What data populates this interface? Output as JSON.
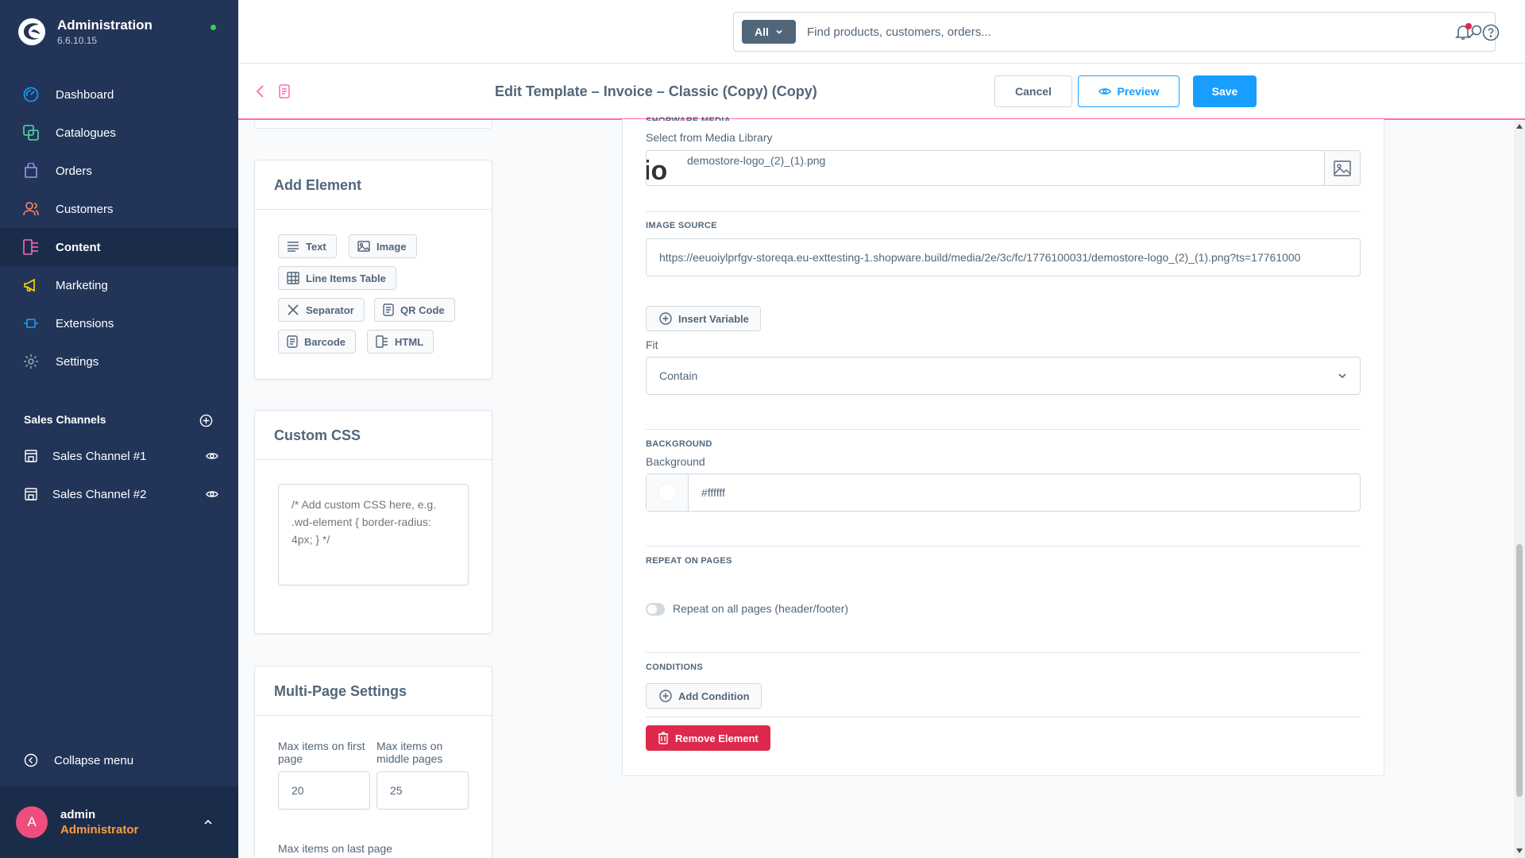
{
  "brand": {
    "title": "Administration",
    "version": "6.6.10.15"
  },
  "nav": [
    {
      "label": "Dashboard",
      "icon": "dashboard-icon",
      "color": "#189eff"
    },
    {
      "label": "Catalogues",
      "icon": "catalogues-icon",
      "color": "#57d9a3"
    },
    {
      "label": "Orders",
      "icon": "orders-icon",
      "color": "#a092f0"
    },
    {
      "label": "Customers",
      "icon": "customers-icon",
      "color": "#f88962"
    },
    {
      "label": "Content",
      "icon": "content-icon",
      "color": "#ff68b4",
      "active": true
    },
    {
      "label": "Marketing",
      "icon": "marketing-icon",
      "color": "#ffd700"
    },
    {
      "label": "Extensions",
      "icon": "extensions-icon",
      "color": "#189eff"
    },
    {
      "label": "Settings",
      "icon": "settings-icon",
      "color": "#9aa8b5"
    }
  ],
  "sales_channels": {
    "title": "Sales Channels",
    "items": [
      {
        "label": "Sales Channel #1"
      },
      {
        "label": "Sales Channel #2"
      }
    ]
  },
  "collapse_label": "Collapse menu",
  "user": {
    "initial": "A",
    "name": "admin",
    "role": "Administrator"
  },
  "search": {
    "scope": "All",
    "placeholder": "Find products, customers, orders..."
  },
  "smartbar": {
    "title": "Edit Template – Invoice – Classic (Copy) (Copy)",
    "cancel": "Cancel",
    "preview": "Preview",
    "save": "Save"
  },
  "add_element": {
    "title": "Add Element",
    "buttons": {
      "text": "Text",
      "image": "Image",
      "line_items": "Line Items Table",
      "separator": "Separator",
      "qr": "QR Code",
      "barcode": "Barcode",
      "html": "HTML"
    }
  },
  "custom_css": {
    "title": "Custom CSS",
    "placeholder": "/* Add custom CSS here, e.g. .wd-element { border-radius: 4px; } */"
  },
  "multipage": {
    "title": "Multi-Page Settings",
    "first_label": "Max items on first page",
    "first_value": "20",
    "middle_label": "Max items on middle pages",
    "middle_value": "25",
    "last_label": "Max items on last page"
  },
  "panel": {
    "media_section": "SHOPWARE MEDIA",
    "media_label": "Select from Media Library",
    "media_file": "demostore-logo_(2)_(1).png",
    "media_thumb_text": "io",
    "image_source_section": "IMAGE SOURCE",
    "image_source_value": "https://eeuoiylprfgv-storeqa.eu-exttesting-1.shopware.build/media/2e/3c/fc/1776100031/demostore-logo_(2)_(1).png?ts=17761000",
    "insert_variable": "Insert Variable",
    "fit_label": "Fit",
    "fit_value": "Contain",
    "background_section": "BACKGROUND",
    "background_label": "Background",
    "background_value": "#ffffff",
    "repeat_section": "REPEAT ON PAGES",
    "repeat_label": "Repeat on all pages (header/footer)",
    "repeat_on": false,
    "conditions_section": "CONDITIONS",
    "add_condition": "Add Condition",
    "remove_element": "Remove Element"
  }
}
